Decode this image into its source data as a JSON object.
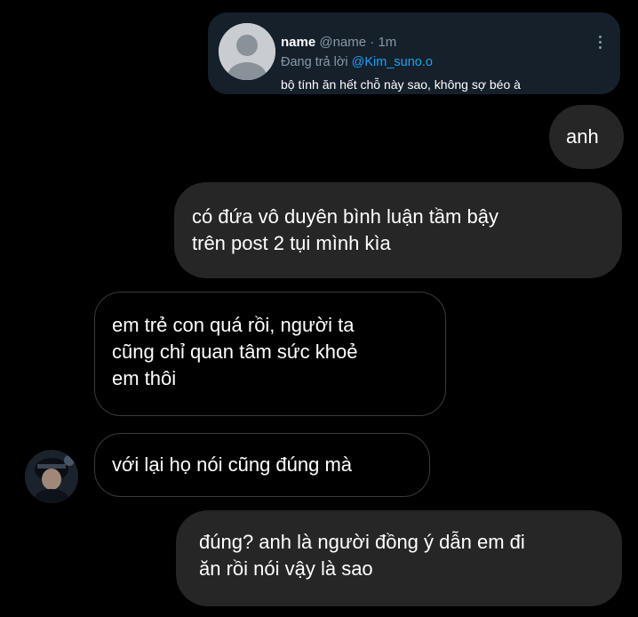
{
  "quoted_tweet": {
    "name": "name",
    "handle": "@name",
    "separator": " · ",
    "time": "1m",
    "reply_prefix": "Đang trả lời ",
    "reply_to": "@Kim_suno.o",
    "text": "bộ tính ăn hết chỗ này sao, không sợ béo à",
    "icons": {
      "avatar": "default-profile-icon",
      "menu": "more-vertical-icon"
    }
  },
  "messages": [
    {
      "side": "outgoing",
      "lines": [
        "anh"
      ]
    },
    {
      "side": "outgoing",
      "lines": [
        "có đứa vô duyên bình luận tầm bậy",
        "trên post 2 tụi mình kìa"
      ]
    },
    {
      "side": "incoming",
      "lines": [
        "em trẻ con quá rồi, người ta",
        "cũng chỉ quan tâm sức khoẻ",
        "em thôi"
      ]
    },
    {
      "side": "incoming",
      "lines": [
        "với lại họ nói cũng đúng mà"
      ]
    },
    {
      "side": "outgoing",
      "lines": [
        "đúng? anh là người đồng ý dẫn em đi",
        "ăn rồi nói vậy là sao"
      ]
    }
  ],
  "colors": {
    "background": "#000000",
    "outgoing_bubble": "#262626",
    "incoming_border": "#3a3a3a",
    "tweet_card": "#15202b",
    "muted_text": "#8899a6",
    "mention": "#1da1f2"
  }
}
